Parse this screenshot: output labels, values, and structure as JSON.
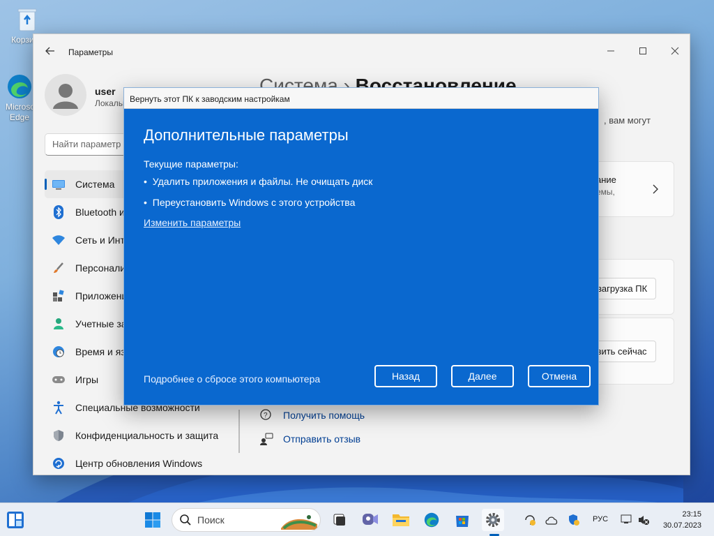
{
  "desktop": {
    "icons": [
      {
        "label": "Корзина"
      },
      {
        "label": "Microsoft Edge"
      }
    ]
  },
  "settings_window": {
    "title": "Параметры",
    "user": {
      "name": "user",
      "account_type": "Локальная учетная запись"
    },
    "search_placeholder": "Найти параметр",
    "nav_items": [
      {
        "label": "Система",
        "icon": "monitor-icon",
        "active": true
      },
      {
        "label": "Bluetooth и устройства",
        "icon": "bluetooth-icon"
      },
      {
        "label": "Сеть и Интернет",
        "icon": "wifi-icon"
      },
      {
        "label": "Персонализация",
        "icon": "brush-icon"
      },
      {
        "label": "Приложения",
        "icon": "apps-icon"
      },
      {
        "label": "Учетные записи",
        "icon": "person-icon"
      },
      {
        "label": "Время и язык",
        "icon": "clock-globe-icon"
      },
      {
        "label": "Игры",
        "icon": "gamepad-icon"
      },
      {
        "label": "Специальные возможности",
        "icon": "accessibility-icon"
      },
      {
        "label": "Конфиденциальность и защита",
        "icon": "shield-icon"
      },
      {
        "label": "Центр обновления Windows",
        "icon": "update-icon"
      }
    ],
    "breadcrumb": {
      "parent": "Система",
      "separator": "›",
      "current": "Восстановление"
    },
    "description_tail": ", вам могут",
    "card1": {
      "title_tail": "ание",
      "sub_tail": "емы,"
    },
    "card2": {
      "button": "езагрузка ПК"
    },
    "card3": {
      "button": "узить сейчас"
    },
    "help_links": [
      {
        "label": "Получить помощь",
        "icon": "help-icon"
      },
      {
        "label": "Отправить отзыв",
        "icon": "feedback-icon"
      }
    ]
  },
  "dialog": {
    "title": "Вернуть этот ПК к заводским настройкам",
    "heading": "Дополнительные параметры",
    "current_label": "Текущие параметры:",
    "bullets": [
      "Удалить приложения и файлы. Не очищать диск",
      "Переустановить Windows с этого устройства"
    ],
    "bullet_char": "•",
    "change_link": "Изменить параметры",
    "footer_link": "Подробнее о сбросе этого компьютера",
    "buttons": {
      "back": "Назад",
      "next": "Далее",
      "cancel": "Отмена"
    }
  },
  "taskbar": {
    "search_placeholder": "Поиск",
    "language": "РУС",
    "time": "23:15",
    "date": "30.07.2023"
  },
  "colors": {
    "accent": "#005fb8",
    "dialog_bg": "#0a68cf",
    "window_bg": "#f3f3f3"
  }
}
